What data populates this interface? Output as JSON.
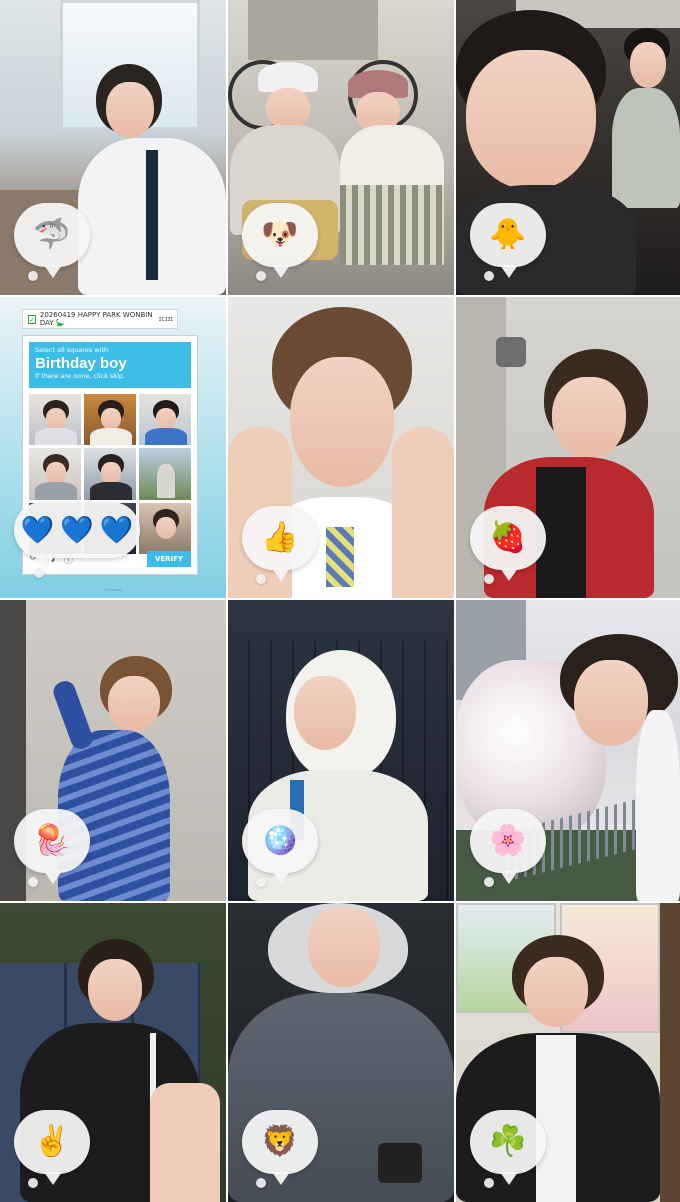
{
  "tiles": [
    {
      "id": "t1",
      "emoji": "🦈"
    },
    {
      "id": "t2",
      "emoji": "🐶"
    },
    {
      "id": "t3",
      "emoji": "🐥"
    },
    {
      "id": "t4",
      "emoji": "💙"
    },
    {
      "id": "t5",
      "emoji": "👍"
    },
    {
      "id": "t6",
      "emoji": "🍓"
    },
    {
      "id": "t7",
      "emoji": "🪼"
    },
    {
      "id": "t8",
      "emoji": "🪩"
    },
    {
      "id": "t9",
      "emoji": "🌸"
    },
    {
      "id": "t10",
      "emoji": "✌️"
    },
    {
      "id": "t11",
      "emoji": "🦁"
    },
    {
      "id": "t12",
      "emoji": "☘️"
    }
  ],
  "captcha": {
    "banner": "20260419 HAPPY PARK WONBIN DAY 🦕",
    "banner_tag": "ɪᴄɪɪɪ",
    "check": "✓",
    "instruction": "Select all squares with",
    "title": "Birthday boy",
    "hint": "If there are none, click skip.",
    "verify_label": "VERIFY",
    "hearts": [
      "💙",
      "💙",
      "💙"
    ],
    "icons": [
      "↻",
      "🎧",
      "ⓘ"
    ],
    "credit": "ᵉᶜᵗᵉˢᵘᵈ"
  },
  "colors": {
    "captcha_blue": "#3bbde8",
    "bubble_bg": "#f5f5f5"
  }
}
